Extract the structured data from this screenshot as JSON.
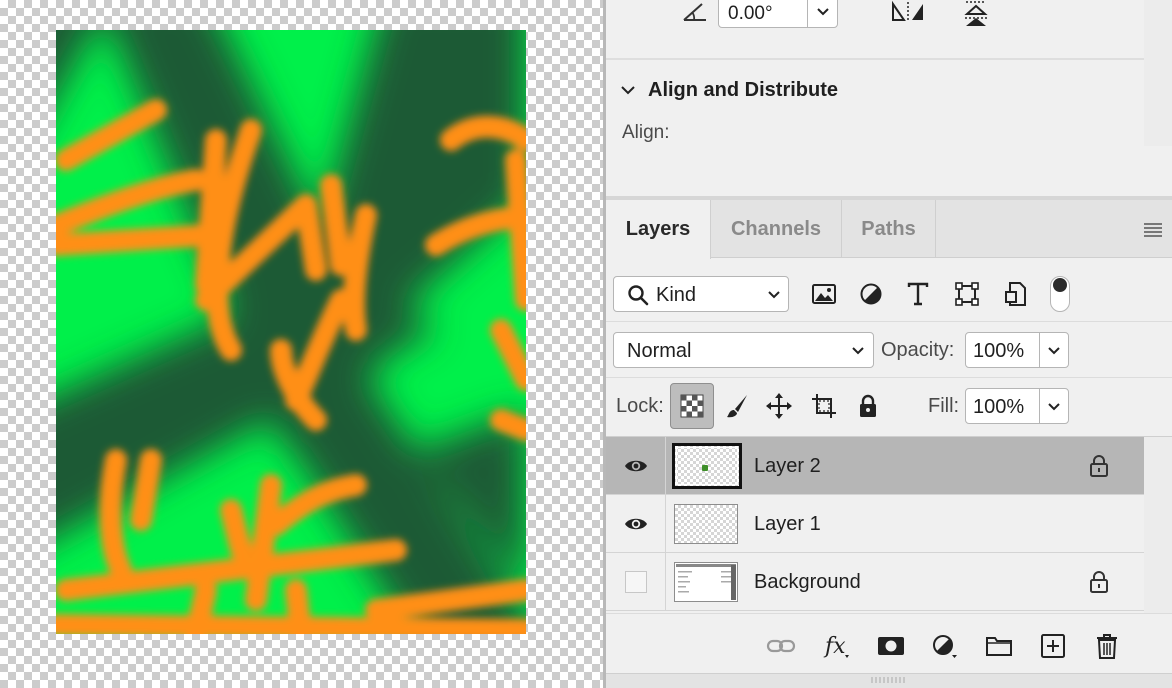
{
  "transform": {
    "angle_value": "0.00°"
  },
  "align_section": {
    "title": "Align and Distribute",
    "align_label": "Align:"
  },
  "layers_panel": {
    "tabs": [
      {
        "label": "Layers",
        "active": true
      },
      {
        "label": "Channels",
        "active": false
      },
      {
        "label": "Paths",
        "active": false
      }
    ],
    "filter": {
      "kind_label": "Kind",
      "filter_icons": [
        "image-icon",
        "adjustment-icon",
        "type-icon",
        "shape-icon",
        "smart-object-icon"
      ]
    },
    "blend": {
      "mode": "Normal",
      "opacity_label": "Opacity:",
      "opacity_value": "100%"
    },
    "lock": {
      "label": "Lock:",
      "fill_label": "Fill:",
      "fill_value": "100%"
    },
    "layers": [
      {
        "name": "Layer 2",
        "visible": true,
        "selected": true,
        "locked": true
      },
      {
        "name": "Layer 1",
        "visible": true,
        "selected": false,
        "locked": false
      },
      {
        "name": "Background",
        "visible": false,
        "selected": false,
        "locked": true
      }
    ],
    "footer_icons": [
      "link-icon",
      "fx-icon",
      "mask-icon",
      "adjustment-layer-icon",
      "folder-icon",
      "new-layer-icon",
      "trash-icon"
    ]
  },
  "colors": {
    "artwork_green": "#00f04a",
    "artwork_dark_green": "#1d5a35",
    "artwork_orange": "#ff8f14",
    "selected_row": "#b6b6b6"
  }
}
